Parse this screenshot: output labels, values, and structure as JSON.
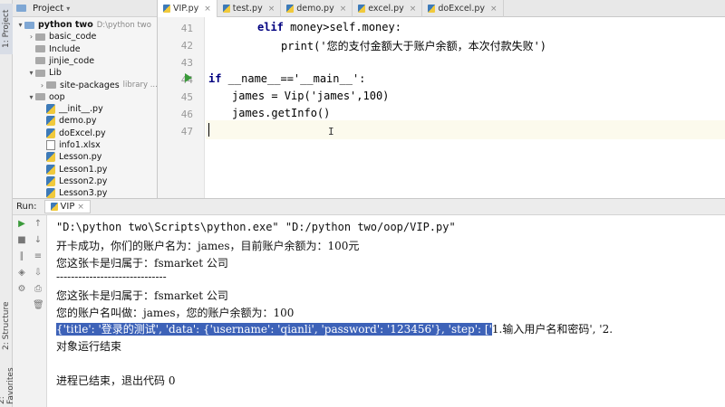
{
  "left_strip": {
    "project_tab": "1: Project",
    "structure_tab": "2: Structure",
    "favorites_tab": "2: Favorites"
  },
  "project": {
    "header": "Project",
    "tree": [
      {
        "label": "python two",
        "hint": "D:\\python two",
        "kind": "folder-blue",
        "expanded": true
      },
      {
        "label": "basic_code",
        "kind": "folder",
        "expanded": false
      },
      {
        "label": "Include",
        "kind": "folder",
        "expanded": null
      },
      {
        "label": "jinjie_code",
        "kind": "folder",
        "expanded": null
      },
      {
        "label": "Lib",
        "kind": "folder",
        "expanded": true
      },
      {
        "label": "site-packages",
        "hint": "library ...",
        "kind": "folder",
        "expanded": false
      },
      {
        "label": "oop",
        "kind": "folder",
        "expanded": true
      },
      {
        "label": "__init__.py",
        "kind": "py"
      },
      {
        "label": "demo.py",
        "kind": "py"
      },
      {
        "label": "doExcel.py",
        "kind": "py"
      },
      {
        "label": "info1.xlsx",
        "kind": "xls"
      },
      {
        "label": "Lesson.py",
        "kind": "py"
      },
      {
        "label": "Lesson1.py",
        "kind": "py"
      },
      {
        "label": "Lesson2.py",
        "kind": "py"
      },
      {
        "label": "Lesson3.py",
        "kind": "py"
      }
    ]
  },
  "tabs": [
    {
      "label": "VIP.py",
      "active": true
    },
    {
      "label": "test.py",
      "active": false
    },
    {
      "label": "demo.py",
      "active": false
    },
    {
      "label": "excel.py",
      "active": false
    },
    {
      "label": "doExcel.py",
      "active": false
    }
  ],
  "editor": {
    "line_numbers": [
      "41",
      "42",
      "43",
      "44",
      "45",
      "46",
      "47"
    ],
    "lines": [
      {
        "kw": "elif",
        "rest": " money>self.money:"
      },
      {
        "text": "print('您的支付金额大于账户余额，本次付款失败')"
      },
      {
        "text": ""
      },
      {
        "kw": "if",
        "rest": " __name__=='__main__':"
      },
      {
        "text": "james = Vip('james',100)"
      },
      {
        "text": "james.getInfo()"
      },
      {
        "text": ""
      }
    ]
  },
  "run": {
    "label": "Run:",
    "config": "VIP",
    "console": [
      "\"D:\\python two\\Scripts\\python.exe\" \"D:/python two/oop/VIP.py\"",
      "开卡成功，你们的账户名为：james，目前账户余额为：100元",
      "您这张卡是归属于：fsmarket 公司",
      "------------------------------",
      "您这张卡是归属于：fsmarket 公司",
      "您的账户名叫做：james，您的账户余额为：100",
      "{'title': '登录的测试', 'data': {'username': 'qianli', 'password': '123456'}, 'step': ['1.输入用户名和密码', '2.",
      "对象运行结束",
      "",
      "进程已结束，退出代码 0"
    ]
  }
}
